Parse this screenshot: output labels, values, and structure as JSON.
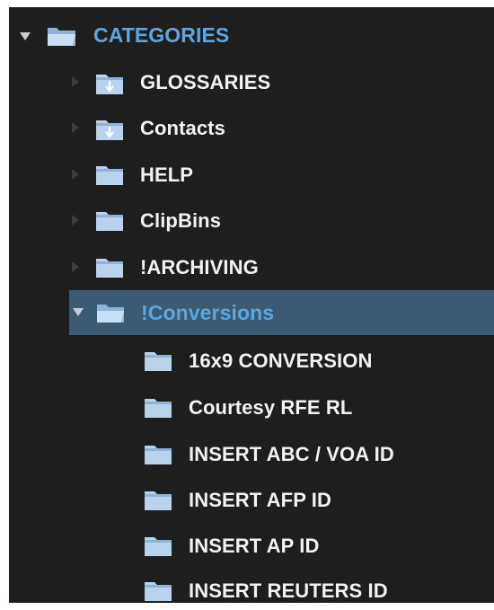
{
  "tree": {
    "root": {
      "label": "CATEGORIES",
      "icon": "folder-open-icon",
      "expanded": true
    },
    "items": [
      {
        "label": "GLOSSARIES",
        "icon": "folder-download-icon",
        "expanded": false
      },
      {
        "label": "Contacts",
        "icon": "folder-download-icon",
        "expanded": false
      },
      {
        "label": "HELP",
        "icon": "folder-icon",
        "expanded": false
      },
      {
        "label": "ClipBins",
        "icon": "folder-icon",
        "expanded": false
      },
      {
        "label": "!ARCHIVING",
        "icon": "folder-icon",
        "expanded": false
      },
      {
        "label": "!Conversions",
        "icon": "folder-open-icon",
        "expanded": true,
        "selected": true
      }
    ],
    "children": [
      {
        "label": "16x9 CONVERSION",
        "icon": "folder-icon"
      },
      {
        "label": "Courtesy RFE RL",
        "icon": "folder-icon"
      },
      {
        "label": "INSERT ABC / VOA ID",
        "icon": "folder-icon"
      },
      {
        "label": "INSERT AFP ID",
        "icon": "folder-icon"
      },
      {
        "label": "INSERT AP ID",
        "icon": "folder-icon"
      },
      {
        "label": "INSERT REUTERS ID",
        "icon": "folder-icon"
      }
    ]
  },
  "colors": {
    "panel_bg": "#1e1e1e",
    "selected_bg": "#3c5a72",
    "accent_text": "#5aa7e4",
    "text": "#f2f2f2",
    "folder": "#b9d3ec"
  }
}
